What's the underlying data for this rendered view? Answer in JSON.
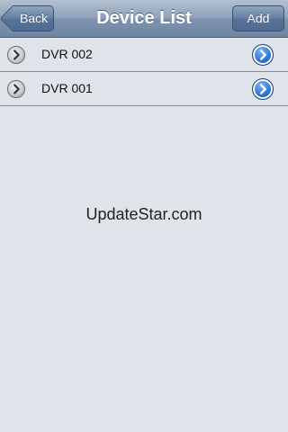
{
  "navbar": {
    "title": "Device List",
    "back_label": "Back",
    "add_label": "Add"
  },
  "devices": [
    {
      "name": "DVR 002",
      "left_icon": "chevron-right-icon",
      "right_icon": "detail-disclosure-icon"
    },
    {
      "name": "DVR 001",
      "left_icon": "chevron-right-icon",
      "right_icon": "detail-disclosure-icon"
    }
  ],
  "watermark": "UpdateStar.com",
  "colors": {
    "navbar": "#8ea2ba",
    "background": "#dfe4ea",
    "separator": "#6b8db8",
    "disclosure_blue": "#2f72d6"
  }
}
